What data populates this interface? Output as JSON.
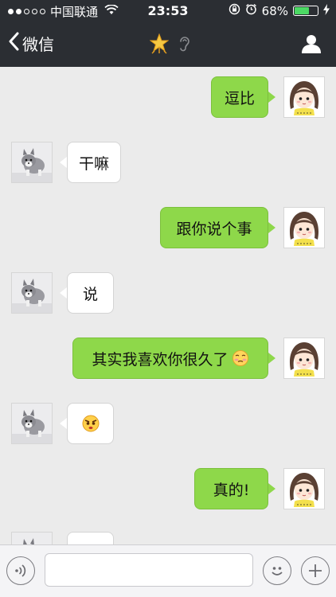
{
  "status_bar": {
    "carrier": "中国联通",
    "time": "23:53",
    "battery_label": "68%",
    "battery_level": 0.68,
    "signal_strength": 2,
    "signal_max": 5
  },
  "nav": {
    "back_label": "微信",
    "back_icon": "chevron-left-icon",
    "title_icons": [
      "star-icon",
      "ear-icon"
    ],
    "profile_icon": "person-icon"
  },
  "messages": [
    {
      "from": "me",
      "text": "逗比"
    },
    {
      "from": "friend",
      "text": "干嘛"
    },
    {
      "from": "me",
      "text": "跟你说个事"
    },
    {
      "from": "friend",
      "text": "说"
    },
    {
      "from": "me",
      "text": "其实我喜欢你很久了",
      "emoji": "shy-face-emoji"
    },
    {
      "from": "friend",
      "text": "",
      "emoji": "angry-face-emoji"
    },
    {
      "from": "me",
      "text": "真的!"
    },
    {
      "from": "friend",
      "text": ""
    }
  ],
  "input_bar": {
    "voice_icon": "voice-icon",
    "emoji_icon": "smiley-icon",
    "add_icon": "plus-icon",
    "text_value": ""
  },
  "colors": {
    "header_bg": "#2b2e33",
    "chat_bg": "#ebebeb",
    "sent_bubble": "#8ed84a",
    "received_bubble": "#ffffff",
    "battery_fill": "#4cd964"
  }
}
